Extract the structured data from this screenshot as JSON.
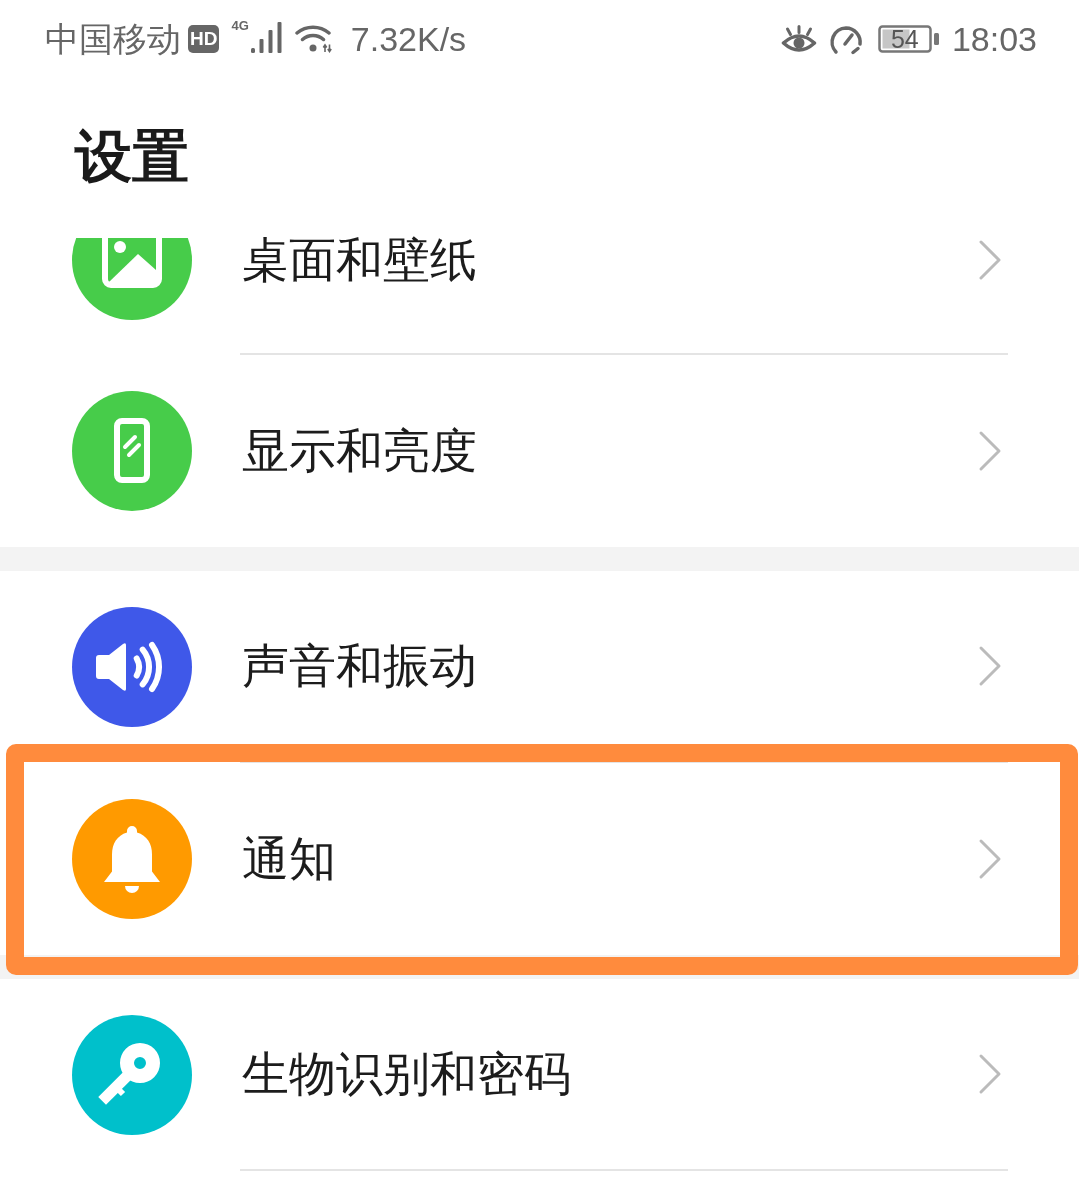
{
  "status_bar": {
    "carrier": "中国移动",
    "hd_badge": "HD",
    "network_type": "4G",
    "speed": "7.32K/s",
    "battery": "54",
    "time": "18:03"
  },
  "title": "设置",
  "groups": [
    {
      "items": [
        {
          "label": "桌面和壁纸",
          "color": "#47cc4a",
          "highlighted": false
        },
        {
          "label": "显示和亮度",
          "color": "#47cc4a",
          "highlighted": false
        }
      ]
    },
    {
      "items": [
        {
          "label": "声音和振动",
          "color": "#3f58e9",
          "highlighted": false
        },
        {
          "label": "通知",
          "color": "#ff9a00",
          "highlighted": true
        }
      ]
    },
    {
      "items": [
        {
          "label": "生物识别和密码",
          "color": "#00c0cb",
          "highlighted": false
        }
      ]
    }
  ]
}
